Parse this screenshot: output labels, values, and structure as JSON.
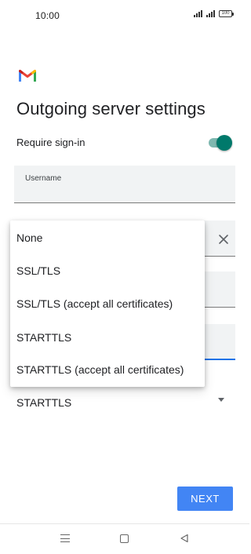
{
  "status_bar": {
    "time": "10:00",
    "battery": "100",
    "icons": [
      "signal-icon",
      "signal-icon",
      "battery-icon"
    ]
  },
  "header": {
    "logo": "gmail-logo",
    "title": "Outgoing server settings"
  },
  "require_signin": {
    "label": "Require sign-in",
    "enabled": true,
    "toggle_color": "#00796b"
  },
  "fields": {
    "username_label": "Username"
  },
  "security": {
    "selected": "STARTTLS",
    "options": [
      "None",
      "SSL/TLS",
      "SSL/TLS (accept all certificates)",
      "STARTTLS",
      "STARTTLS (accept all certificates)"
    ]
  },
  "footer": {
    "next_label": "NEXT"
  },
  "colors": {
    "accent": "#4285f4",
    "focus_underline": "#1a73e8"
  }
}
